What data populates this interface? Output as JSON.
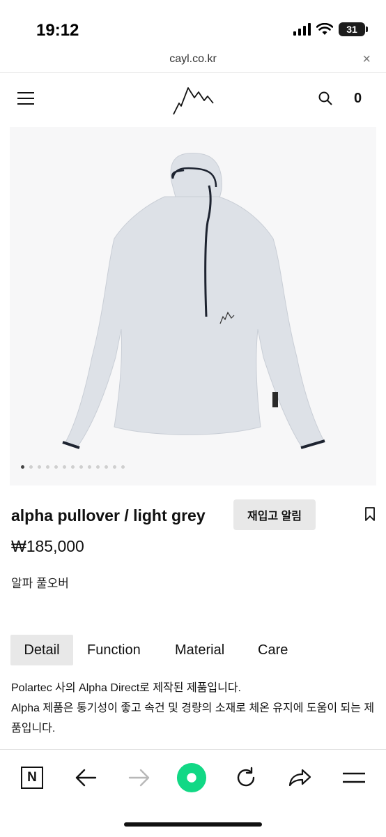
{
  "status_bar": {
    "time": "19:12",
    "battery": "31"
  },
  "browser": {
    "url": "cayl.co.kr",
    "close_symbol": "×"
  },
  "header": {
    "cart_count": "0"
  },
  "product": {
    "title": "alpha pullover / light grey",
    "price": "₩185,000",
    "subtitle": "알파 풀오버",
    "restock_label": "재입고 알림",
    "image_index": 1,
    "image_count": 13
  },
  "tabs": [
    {
      "label": "Detail",
      "active": true
    },
    {
      "label": "Function",
      "active": false
    },
    {
      "label": "Material",
      "active": false
    },
    {
      "label": "Care",
      "active": false
    }
  ],
  "description": {
    "line1": "Polartec 사의 Alpha Direct로 제작된 제품입니다.",
    "line2": "Alpha 제품은 통기성이 좋고 속건 및 경량의 소재로 체온 유지에 도움이 되는 제품입니다."
  },
  "toolbar": {
    "naver_letter": "N",
    "icons": [
      "naver-icon",
      "back-arrow-icon",
      "forward-arrow-icon",
      "green-circle-icon",
      "reload-icon",
      "share-icon",
      "menu-icon"
    ]
  },
  "colors": {
    "accent_green": "#12d885",
    "tab_active_bg": "#e8e8e8",
    "garment": "#dde1e7"
  }
}
